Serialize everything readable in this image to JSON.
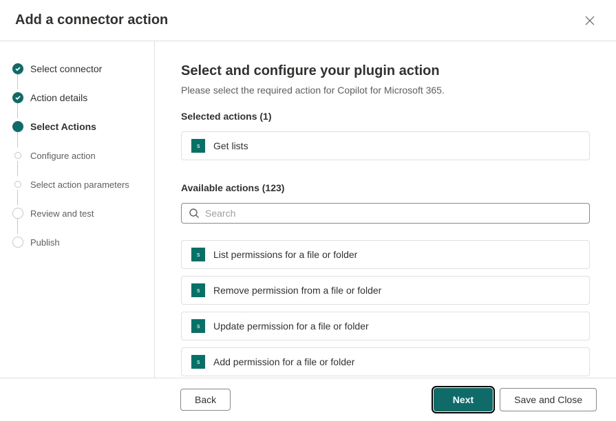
{
  "header": {
    "title": "Add a connector action"
  },
  "sidebar": {
    "steps": [
      {
        "label": "Select connector",
        "state": "completed"
      },
      {
        "label": "Action details",
        "state": "completed"
      },
      {
        "label": "Select Actions",
        "state": "current"
      },
      {
        "label": "Configure action",
        "state": "upcoming"
      },
      {
        "label": "Select action parameters",
        "state": "upcoming"
      },
      {
        "label": "Review and test",
        "state": "upcoming_big"
      },
      {
        "label": "Publish",
        "state": "upcoming_big"
      }
    ]
  },
  "main": {
    "title": "Select and configure your plugin action",
    "subtitle": "Please select the required action for Copilot for Microsoft 365.",
    "selected_label": "Selected actions (1)",
    "available_label": "Available actions (123)",
    "selected_count": 1,
    "available_count": 123,
    "search_placeholder": "Search",
    "selected_actions": [
      {
        "label": "Get lists"
      }
    ],
    "available_actions": [
      {
        "label": "List permissions for a file or folder"
      },
      {
        "label": "Remove permission from a file or folder"
      },
      {
        "label": "Update permission for a file or folder"
      },
      {
        "label": "Add permission for a file or folder"
      }
    ]
  },
  "footer": {
    "back": "Back",
    "next": "Next",
    "save_close": "Save and Close"
  },
  "icon": {
    "sharepoint_glyph": "s"
  }
}
